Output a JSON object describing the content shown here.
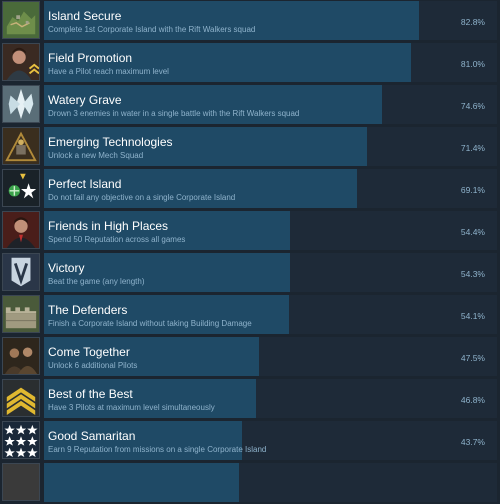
{
  "achievements": [
    {
      "title": "Island Secure",
      "description": "Complete 1st Corporate Island with the Rift Walkers squad",
      "percent_label": "82.8%",
      "percent": 82.8,
      "icon": "island-map-icon"
    },
    {
      "title": "Field Promotion",
      "description": "Have a Pilot reach maximum level",
      "percent_label": "81.0%",
      "percent": 81.0,
      "icon": "pilot-portrait-icon"
    },
    {
      "title": "Watery Grave",
      "description": "Drown 3 enemies in water in a single battle with the Rift Walkers squad",
      "percent_label": "74.6%",
      "percent": 74.6,
      "icon": "ice-crystal-icon"
    },
    {
      "title": "Emerging Technologies",
      "description": "Unlock a new Mech Squad",
      "percent_label": "71.4%",
      "percent": 71.4,
      "icon": "mech-hangar-icon"
    },
    {
      "title": "Perfect Island",
      "description": "Do not fail any objective on a single Corporate Island",
      "percent_label": "69.1%",
      "percent": 69.1,
      "icon": "objectives-star-icon"
    },
    {
      "title": "Friends in High Places",
      "description": "Spend 50 Reputation across all games",
      "percent_label": "54.4%",
      "percent": 54.4,
      "icon": "ceo-portrait-icon"
    },
    {
      "title": "Victory",
      "description": "Beat the game (any length)",
      "percent_label": "54.3%",
      "percent": 54.3,
      "icon": "victory-banner-icon"
    },
    {
      "title": "The Defenders",
      "description": "Finish a Corporate Island without taking Building Damage",
      "percent_label": "54.1%",
      "percent": 54.1,
      "icon": "defense-wall-icon"
    },
    {
      "title": "Come Together",
      "description": "Unlock 6 additional Pilots",
      "percent_label": "47.5%",
      "percent": 47.5,
      "icon": "pilot-group-icon"
    },
    {
      "title": "Best of the Best",
      "description": "Have 3 Pilots at maximum level simultaneously",
      "percent_label": "46.8%",
      "percent": 46.8,
      "icon": "rank-chevrons-icon"
    },
    {
      "title": "Good Samaritan",
      "description": "Earn 9 Reputation from missions on a single Corporate Island",
      "percent_label": "43.7%",
      "percent": 43.7,
      "icon": "reputation-stars-icon"
    },
    {
      "title": "",
      "description": "",
      "percent_label": "",
      "percent": 43.0,
      "icon": "partial-row-icon"
    }
  ]
}
